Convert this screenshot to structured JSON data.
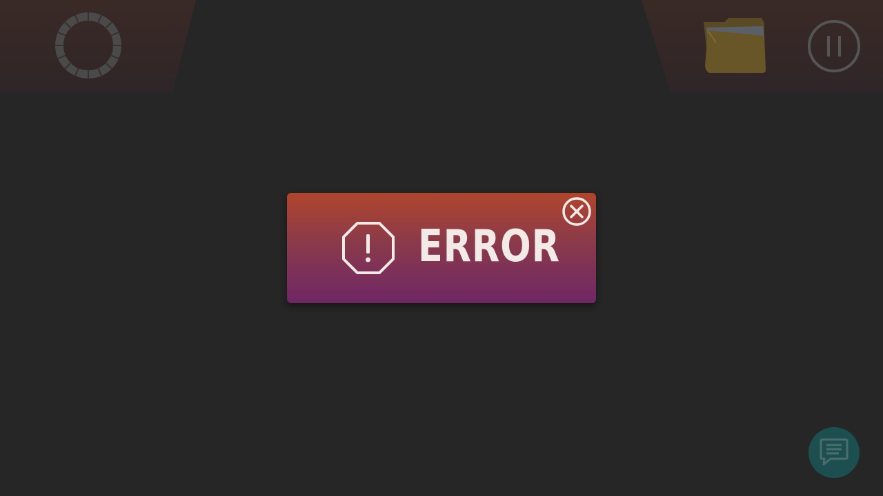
{
  "dialog": {
    "title": "ERROR",
    "icon": "octagon-exclamation-icon",
    "close_icon": "close-circle-icon"
  },
  "hud": {
    "loading_icon": "loading-ring-icon",
    "folder_icon": "folder-icon",
    "pause_icon": "pause-icon",
    "chat_icon": "chat-bubble-icon"
  },
  "colors": {
    "background": "#262626",
    "dialog_top": "#b0452c",
    "dialog_bottom": "#6f2766",
    "text": "#f3eae8",
    "chat_button": "#1e4f50"
  }
}
